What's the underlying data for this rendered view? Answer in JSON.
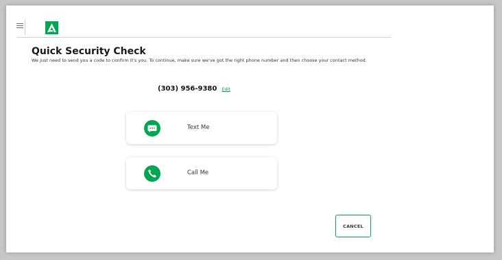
{
  "header": {
    "menu_icon": "hamburger-icon",
    "logo_icon": "brand-logo-a",
    "brand_color": "#00a651"
  },
  "main": {
    "title": "Quick Security Check",
    "description": "We just need to send you a code to confirm it's you. To continue, make sure we've got the right phone number and then choose your contact method.",
    "phone_number": "(303) 956-9380",
    "edit_label": "Edit",
    "options": [
      {
        "label": "Text Me",
        "icon": "chat-bubble-icon"
      },
      {
        "label": "Call Me",
        "icon": "phone-icon"
      }
    ]
  },
  "footer": {
    "cancel_label": "CANCEL"
  }
}
